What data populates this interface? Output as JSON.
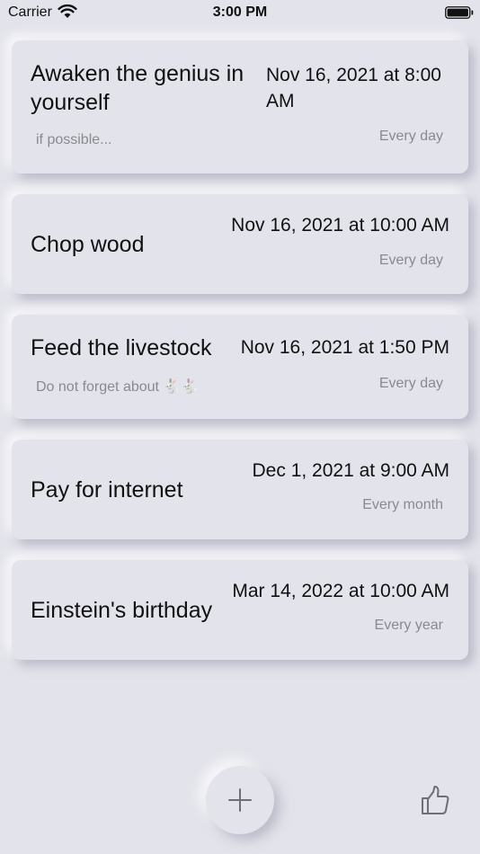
{
  "status_bar": {
    "carrier": "Carrier",
    "time": "3:00 PM"
  },
  "reminders": [
    {
      "title_line1": "Awaken the genius in",
      "title_line2": "yourself",
      "date_line1": "Nov 16, 2021 at 8:00",
      "date_line2": "AM",
      "note": "if possible...",
      "repeat": "Every day"
    },
    {
      "title": "Chop wood",
      "date": "Nov 16, 2021 at 10:00 AM",
      "note": "",
      "repeat": "Every day"
    },
    {
      "title": "Feed the livestock",
      "date": "Nov 16, 2021 at 1:50 PM",
      "note": "Do not forget about 🐇🐇",
      "repeat": "Every day"
    },
    {
      "title": "Pay for internet",
      "date": "Dec 1, 2021 at 9:00 AM",
      "note": "",
      "repeat": "Every month"
    },
    {
      "title": "Einstein's birthday",
      "date": "Mar 14, 2022 at 10:00 AM",
      "note": "",
      "repeat": "Every year"
    }
  ],
  "icons": {
    "add": "plus-icon",
    "like": "thumbs-up-icon",
    "wifi": "wifi-icon",
    "battery": "battery-icon"
  },
  "colors": {
    "background": "#e3e3eb",
    "secondary_text": "#8a8a8e",
    "primary_text": "#111111"
  }
}
